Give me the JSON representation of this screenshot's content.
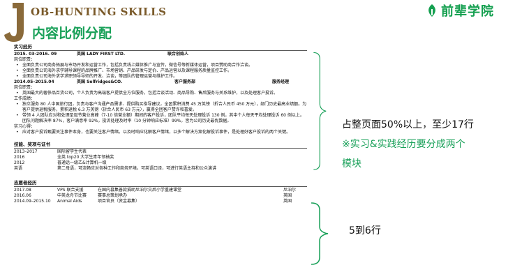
{
  "header": {
    "title_en": "OB-HUNTING SKILLS",
    "title_cn": "内容比例分配",
    "logo_text": "前辈学院",
    "brand_color": "#18a058"
  },
  "resume": {
    "internship": {
      "heading": "实习经历",
      "job1": {
        "date": "2015. 03-2016. 09",
        "company": "英国 LADY FIRST LTD.",
        "role": "联合创始人",
        "duty_label": "岗位职责：",
        "bullets": [
          "全面负责公司商务拓展与市场开发和运营工作，包括负责线上媒体推广与宣传，微信号等新媒体运营，项目赞助商合作洽谈。",
          "全面负责公司海外求学辅导课程的品牌推广、市场营销、产品研发与定价、产品运营以及课程服务质量监控工作。",
          "全面负责公司海外求学求职领导导师的开发、洽谈，等团队的管理运营与维护工作。"
        ]
      },
      "job2": {
        "date": "2014.05–2015.04",
        "company": "英国 Selfridges&CO.",
        "role": "客户服务部",
        "role2": "服务经理",
        "duty_label": "岗位职责：",
        "bullets": [
          "英国最大的奢侈品百货公司，个人负责为高端客户提供全方位服务，包括洽谈活动、商品导购、售后服务与关系维护，以及处理客户投诉。"
        ],
        "achieve_label": "工作成绩：",
        "achievements": [
          "独立服务 80 人中国旅行团，负责与客户沟通产品需求、提供购买指导建议，全团累积消费 45 万英镑（折合人民币 450 万元），部门历史最高业绩额。为客户提供退税服务，累积退税 6.3 万英镑（折合人民币 63 万元），赢得全团客户赞许和喜爱。",
          "带领 4 人团队应对和处理圣诞节营业高峰（7-10 倍营业额）期间的客户投诉，团队平均每天处理投诉 130 例，其中个人每天平均处理投诉 60 例以上。团队问题解决率 87%，客户满意率 92%，投诉处理及时率（10 分钟响应标准）99%，皆为公司历史最优数据。"
        ],
        "insight_label": "实习心得：",
        "insights": [
          "应对客户投诉甄要关注事件本身，也要关注客户情绪。以及时响应化解客户情绪，以多个解决方案化解投诉事件，是处理好客户投诉的两个关键。"
        ]
      }
    },
    "skills": {
      "heading": "技能、奖项与证书",
      "rows": [
        {
          "year": "2013–2017",
          "text": "国际留学生代表"
        },
        {
          "year": "2016",
          "text": "全英 top20 大学生青年领袖奖"
        },
        {
          "year": "2012",
          "text": "普通话一级乙&计算机一级"
        },
        {
          "year": "英语",
          "text": "第二母语，可流畅应对各种工作和商务环境。可英语口译，可进行英语主持和公众演讲"
        }
      ]
    },
    "volunteer": {
      "heading": "志愿者经历",
      "rows": [
        {
          "date": "2017.08",
          "org": "VPS 联合支援",
          "desc": "在国内募集善款捐助尼泊尔灾后小学重建课堂",
          "place": "尼泊尔"
        },
        {
          "date": "2016.06",
          "org": "中英龙舟节比赛",
          "desc": "赛事总策划承办",
          "place": "英国"
        },
        {
          "date": "2014.09–2015.10",
          "org": "Animal Aids",
          "desc": "项目官员（资金募集）",
          "place": "英国"
        }
      ]
    }
  },
  "annotations": {
    "note1_line1": "占整页面50%以上，至少17行",
    "note1_line2": "※实习&实践经历要分成两个",
    "note1_line3": "模块",
    "note2": "5到6行"
  }
}
